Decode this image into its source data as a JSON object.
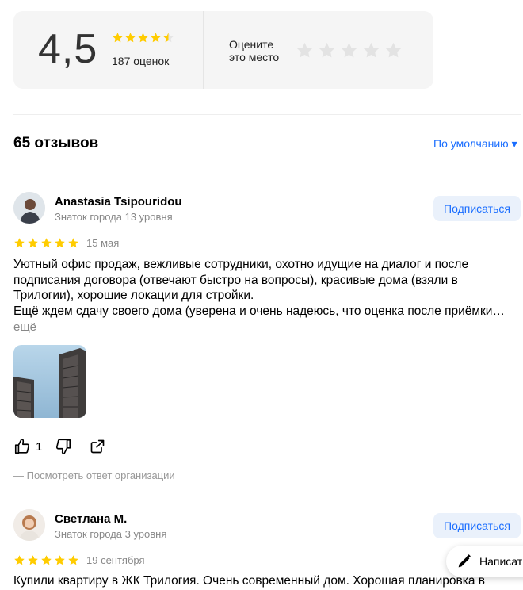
{
  "summary": {
    "score": "4,5",
    "avg_rating": 4.5,
    "ratings_count": "187 оценок",
    "rate_prompt": "Оцените\nэто место",
    "colors": {
      "star": "#ffcc00",
      "star_empty": "#e5e5e5",
      "accent": "#196dff"
    }
  },
  "reviews_header": {
    "count": "65 отзывов",
    "sort_label": "По умолчанию ▾"
  },
  "reviews": [
    {
      "author": "Anastasia Tsipouridou",
      "level": "Знаток города 13 уровня",
      "subscribe_label": "Подписаться",
      "rating": 5,
      "date": "15 мая",
      "text": "Уютный офис продаж, вежливые сотрудники, охотно идущие на диалог и после\nподписания договора (отвечают быстро на вопросы), красивые дома (взяли в\nТрилогии), хорошие локации для стройки.\nЕщё ждем сдачу своего дома (уверена и очень надеюсь, что оценка после приёмки…",
      "more_label": "ещё",
      "likes": "1",
      "org_answer_label": "— Посмотреть ответ организации"
    },
    {
      "author": "Светлана М.",
      "level": "Знаток города 3 уровня",
      "subscribe_label": "Подписаться",
      "rating": 5,
      "date": "19 сентября",
      "text": "Купили квартиру в ЖК Трилогия. Очень современный дом. Хорошая планировка в"
    }
  ],
  "write_review": {
    "label": "Написат"
  },
  "icons": {
    "avg_star": "star-icon",
    "like": "thumbs-up-icon",
    "dislike": "thumbs-down-icon",
    "share": "share-icon",
    "write": "pencil-icon"
  }
}
